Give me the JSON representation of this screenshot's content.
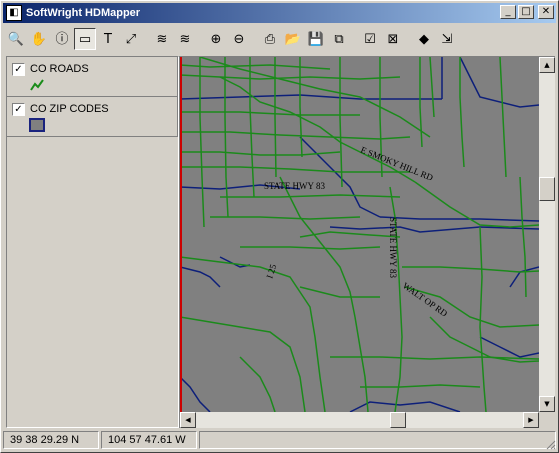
{
  "window": {
    "title": "SoftWright HDMapper",
    "controls": {
      "minimize": "_",
      "maximize": "□",
      "close": "✕"
    }
  },
  "toolbar": {
    "tools": [
      {
        "name": "zoom-tool",
        "icon": "magnifier-icon",
        "glyph": "🔍",
        "pressed": false
      },
      {
        "name": "pan-tool",
        "icon": "hand-icon",
        "glyph": "✋",
        "pressed": false
      },
      {
        "name": "info-tool",
        "icon": "info-icon",
        "glyph": "ⓘ",
        "pressed": false
      },
      {
        "name": "select-tool",
        "icon": "select-icon",
        "glyph": "▭",
        "pressed": true
      },
      {
        "name": "text-tool",
        "icon": "text-icon",
        "glyph": "T",
        "pressed": false
      },
      {
        "name": "measure-tool",
        "icon": "measure-arrow-icon",
        "glyph": "⤢",
        "pressed": false
      },
      {
        "name": "layers-tool",
        "icon": "layers-icon",
        "glyph": "≋",
        "pressed": false
      },
      {
        "name": "layers-edit-tool",
        "icon": "layers-edit-icon",
        "glyph": "≋",
        "pressed": false
      },
      {
        "name": "zoom-in-tool",
        "icon": "zoom-in-icon",
        "glyph": "⊕",
        "pressed": false
      },
      {
        "name": "zoom-out-tool",
        "icon": "zoom-out-icon",
        "glyph": "⊖",
        "pressed": false
      },
      {
        "name": "print-tool",
        "icon": "printer-icon",
        "glyph": "⎙",
        "pressed": false
      },
      {
        "name": "open-tool",
        "icon": "folder-open-icon",
        "glyph": "📂",
        "pressed": false
      },
      {
        "name": "save-tool",
        "icon": "floppy-save-icon",
        "glyph": "💾",
        "pressed": false
      },
      {
        "name": "new-layer-tool",
        "icon": "new-layer-icon",
        "glyph": "⧉",
        "pressed": false
      },
      {
        "name": "properties-tool",
        "icon": "properties-check-icon",
        "glyph": "☑",
        "pressed": false
      },
      {
        "name": "remove-tool",
        "icon": "remove-layer-icon",
        "glyph": "⊠",
        "pressed": false
      },
      {
        "name": "symbol-tool",
        "icon": "symbol-icon",
        "glyph": "◆",
        "pressed": false
      },
      {
        "name": "export-tool",
        "icon": "export-icon",
        "glyph": "⇲",
        "pressed": false
      }
    ]
  },
  "legend": {
    "layers": [
      {
        "name": "CO ROADS",
        "checked": true,
        "symbol": "line",
        "color": "#1a8c1a",
        "check_glyph": "✓"
      },
      {
        "name": "CO ZIP CODES",
        "checked": true,
        "symbol": "polygon",
        "color": "#1a237e",
        "check_glyph": "✓"
      }
    ]
  },
  "map": {
    "background": "#808080",
    "road_color": "#1b8a1b",
    "zip_color": "#0d1f7a",
    "border_color": "#cc0000",
    "labels": [
      "E SMOKY HILL RD",
      "STATE HWY 83",
      "STATE HWY 83",
      "WALT OP RD",
      "I 25"
    ]
  },
  "status": {
    "latitude": "39 38 29.29 N",
    "longitude": "104 57 47.61 W"
  }
}
